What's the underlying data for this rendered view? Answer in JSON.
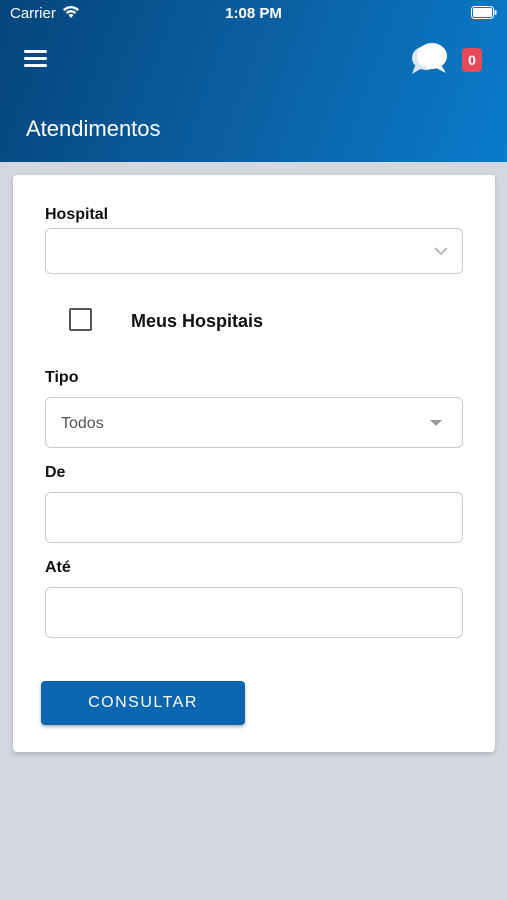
{
  "status_bar": {
    "carrier": "Carrier",
    "time": "1:08 PM",
    "icons": [
      "wifi-icon",
      "battery-icon"
    ]
  },
  "header": {
    "menu_icon": "menu-icon",
    "chat_icon": "chat-icon",
    "notification_count": "0",
    "title": "Atendimentos",
    "gradient_colors": [
      "#05457c",
      "#0a7ccb"
    ],
    "badge_color": "#e64a5b"
  },
  "form": {
    "hospital": {
      "label": "Hospital",
      "value": ""
    },
    "my_hospitals": {
      "label": "Meus Hospitais",
      "checked": false
    },
    "tipo": {
      "label": "Tipo",
      "value": "Todos"
    },
    "de": {
      "label": "De",
      "value": ""
    },
    "ate": {
      "label": "Até",
      "value": ""
    },
    "submit_label": "CONSULTAR",
    "button_color": "#0a66b0"
  }
}
